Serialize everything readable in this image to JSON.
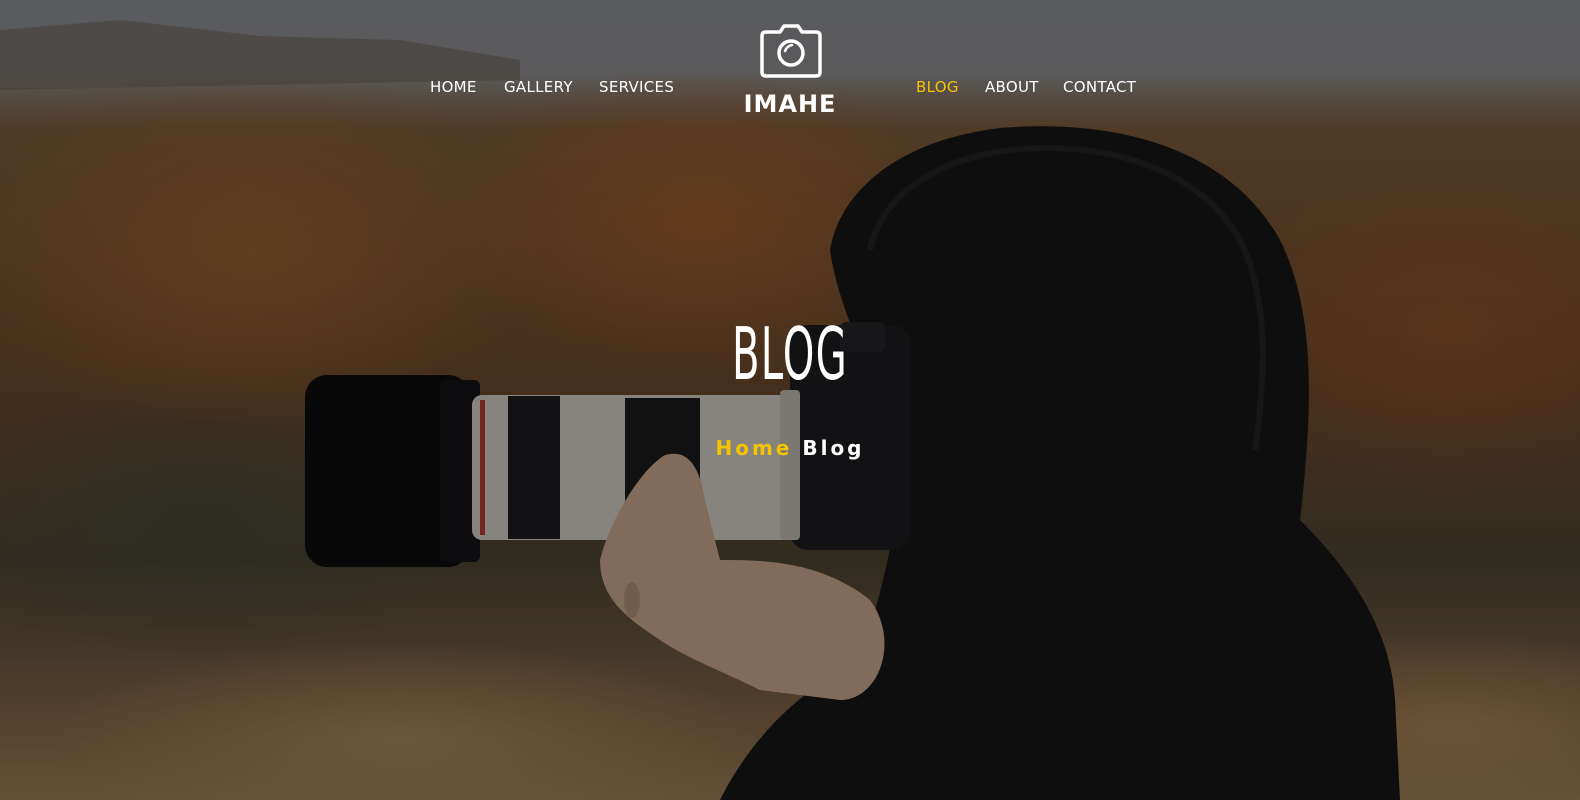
{
  "nav": {
    "left_items": [
      {
        "label": "HOME"
      },
      {
        "label": "GALLERY"
      },
      {
        "label": "SERVICES"
      }
    ],
    "right_items": [
      {
        "label": "BLOG",
        "active": true
      },
      {
        "label": "ABOUT"
      },
      {
        "label": "CONTACT"
      }
    ],
    "active_color": "#f5c400"
  },
  "logo": {
    "icon": "camera-icon",
    "text": "IMAHE"
  },
  "hero": {
    "title": "BLOG",
    "breadcrumb": {
      "home": "Home",
      "current": "Blog"
    }
  },
  "colors": {
    "accent": "#f5c400",
    "text": "#ffffff"
  }
}
